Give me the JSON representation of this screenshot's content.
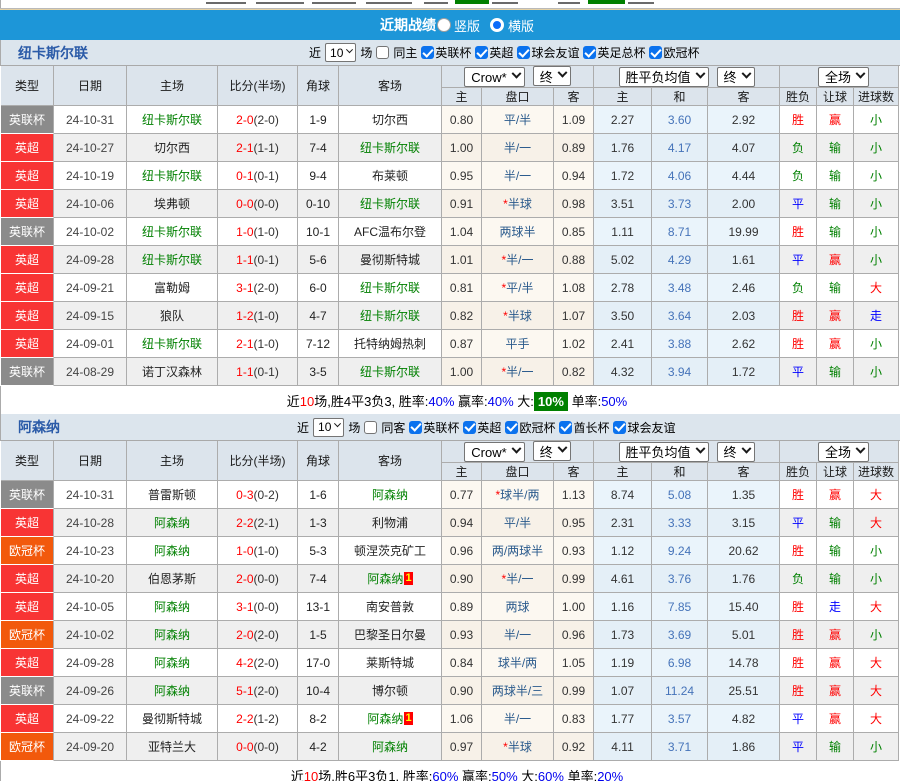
{
  "header": {
    "title": "近期战绩",
    "view_options": [
      {
        "label": "竖版",
        "selected": true
      },
      {
        "label": "横版",
        "selected": false
      }
    ]
  },
  "top_strip": {
    "fragments": [
      [
        206,
        40
      ],
      [
        256,
        48
      ],
      [
        312,
        44
      ],
      [
        366,
        46
      ],
      [
        424,
        24
      ],
      [
        492,
        26
      ],
      [
        558,
        22
      ],
      [
        628,
        26
      ]
    ],
    "green_boxes": [
      [
        455,
        34
      ],
      [
        588,
        37
      ]
    ]
  },
  "columns": {
    "left": [
      "类型",
      "日期",
      "主场",
      "比分(半场)",
      "角球",
      "客场"
    ],
    "bookmaker_select": "Crow*",
    "bookmaker_final_select": "终",
    "odds_sub": [
      "主",
      "盘口",
      "客"
    ],
    "europe_select": "胜平负均值",
    "europe_final_select": "终",
    "europe_sub": [
      "主",
      "和",
      "客"
    ],
    "scope_select": "全场",
    "result_sub": [
      "胜负",
      "让球",
      "进球数"
    ]
  },
  "league_colors": {
    "英超": "#F83434",
    "英联杯": "#8B8B8B",
    "欧冠杯": "#F2590C"
  },
  "result_colors": {
    "胜": "#FF0000",
    "平": "#0000FF",
    "负": "#008000",
    "赢": "#FF0000",
    "输": "#008000",
    "走": "#0000FF",
    "大": "#FF0000",
    "小": "#008000"
  },
  "sections": [
    {
      "team": "纽卡斯尔联",
      "filters": {
        "near": "近",
        "count": "10",
        "unit": "场",
        "same": "同主",
        "same_checked": false,
        "leagues": [
          "英联杯",
          "英超",
          "球会友谊",
          "英足总杯",
          "欧冠杯"
        ]
      },
      "rows": [
        {
          "type": "英联杯",
          "date": "24-10-31",
          "home": "纽卡斯尔联",
          "home_subj": true,
          "home_card": "",
          "score": "2-0",
          "half": "(2-0)",
          "corners": "1-9",
          "away": "切尔西",
          "away_subj": false,
          "away_card": "",
          "o1": "0.80",
          "star": false,
          "hcp": "平/半",
          "o2": "1.09",
          "e1": "2.27",
          "e2": "3.60",
          "e3": "2.92",
          "r1": "胜",
          "r2": "赢",
          "r3": "小"
        },
        {
          "type": "英超",
          "date": "24-10-27",
          "home": "切尔西",
          "home_subj": false,
          "home_card": "",
          "score": "2-1",
          "half": "(1-1)",
          "corners": "7-4",
          "away": "纽卡斯尔联",
          "away_subj": true,
          "away_card": "",
          "o1": "1.00",
          "star": false,
          "hcp": "半/一",
          "o2": "0.89",
          "e1": "1.76",
          "e2": "4.17",
          "e3": "4.07",
          "r1": "负",
          "r2": "输",
          "r3": "小"
        },
        {
          "type": "英超",
          "date": "24-10-19",
          "home": "纽卡斯尔联",
          "home_subj": true,
          "home_card": "",
          "score": "0-1",
          "half": "(0-1)",
          "corners": "9-4",
          "away": "布莱顿",
          "away_subj": false,
          "away_card": "",
          "o1": "0.95",
          "star": false,
          "hcp": "半/一",
          "o2": "0.94",
          "e1": "1.72",
          "e2": "4.06",
          "e3": "4.44",
          "r1": "负",
          "r2": "输",
          "r3": "小"
        },
        {
          "type": "英超",
          "date": "24-10-06",
          "home": "埃弗顿",
          "home_subj": false,
          "home_card": "",
          "score": "0-0",
          "half": "(0-0)",
          "corners": "0-10",
          "away": "纽卡斯尔联",
          "away_subj": true,
          "away_card": "",
          "o1": "0.91",
          "star": true,
          "hcp": "半球",
          "o2": "0.98",
          "e1": "3.51",
          "e2": "3.73",
          "e3": "2.00",
          "r1": "平",
          "r2": "输",
          "r3": "小"
        },
        {
          "type": "英联杯",
          "date": "24-10-02",
          "home": "纽卡斯尔联",
          "home_subj": true,
          "home_card": "",
          "score": "1-0",
          "half": "(1-0)",
          "corners": "10-1",
          "away": "AFC温布尔登",
          "away_subj": false,
          "away_card": "",
          "o1": "1.04",
          "star": false,
          "hcp": "两球半",
          "o2": "0.85",
          "e1": "1.11",
          "e2": "8.71",
          "e3": "19.99",
          "r1": "胜",
          "r2": "输",
          "r3": "小"
        },
        {
          "type": "英超",
          "date": "24-09-28",
          "home": "纽卡斯尔联",
          "home_subj": true,
          "home_card": "",
          "score": "1-1",
          "half": "(0-1)",
          "corners": "5-6",
          "away": "曼彻斯特城",
          "away_subj": false,
          "away_card": "",
          "o1": "1.01",
          "star": true,
          "hcp": "半/一",
          "o2": "0.88",
          "e1": "5.02",
          "e2": "4.29",
          "e3": "1.61",
          "r1": "平",
          "r2": "赢",
          "r3": "小"
        },
        {
          "type": "英超",
          "date": "24-09-21",
          "home": "富勒姆",
          "home_subj": false,
          "home_card": "",
          "score": "3-1",
          "half": "(2-0)",
          "corners": "6-0",
          "away": "纽卡斯尔联",
          "away_subj": true,
          "away_card": "",
          "o1": "0.81",
          "star": true,
          "hcp": "平/半",
          "o2": "1.08",
          "e1": "2.78",
          "e2": "3.48",
          "e3": "2.46",
          "r1": "负",
          "r2": "输",
          "r3": "大"
        },
        {
          "type": "英超",
          "date": "24-09-15",
          "home": "狼队",
          "home_subj": false,
          "home_card": "",
          "score": "1-2",
          "half": "(1-0)",
          "corners": "4-7",
          "away": "纽卡斯尔联",
          "away_subj": true,
          "away_card": "",
          "o1": "0.82",
          "star": true,
          "hcp": "半球",
          "o2": "1.07",
          "e1": "3.50",
          "e2": "3.64",
          "e3": "2.03",
          "r1": "胜",
          "r2": "赢",
          "r3": "走"
        },
        {
          "type": "英超",
          "date": "24-09-01",
          "home": "纽卡斯尔联",
          "home_subj": true,
          "home_card": "",
          "score": "2-1",
          "half": "(1-0)",
          "corners": "7-12",
          "away": "托特纳姆热刺",
          "away_subj": false,
          "away_card": "",
          "o1": "0.87",
          "star": false,
          "hcp": "平手",
          "o2": "1.02",
          "e1": "2.41",
          "e2": "3.88",
          "e3": "2.62",
          "r1": "胜",
          "r2": "赢",
          "r3": "小"
        },
        {
          "type": "英联杯",
          "date": "24-08-29",
          "home": "诺丁汉森林",
          "home_subj": false,
          "home_card": "",
          "score": "1-1",
          "half": "(0-1)",
          "corners": "3-5",
          "away": "纽卡斯尔联",
          "away_subj": true,
          "away_card": "",
          "o1": "1.00",
          "star": true,
          "hcp": "半/一",
          "o2": "0.82",
          "e1": "4.32",
          "e2": "3.94",
          "e3": "1.72",
          "r1": "平",
          "r2": "输",
          "r3": "小"
        }
      ],
      "summary": [
        [
          "近",
          ""
        ],
        [
          "10",
          "red"
        ],
        [
          "场,胜4平3负3, 胜率:",
          ""
        ],
        [
          "40%",
          "pct"
        ],
        [
          " 赢率:",
          ""
        ],
        [
          "40%",
          "pct"
        ],
        [
          " 大:",
          ""
        ],
        [
          "10%",
          "gbox"
        ],
        [
          " 单率:",
          ""
        ],
        [
          "50%",
          "pct"
        ]
      ]
    },
    {
      "team": "阿森纳",
      "filters": {
        "near": "近",
        "count": "10",
        "unit": "场",
        "same": "同客",
        "same_checked": false,
        "leagues": [
          "英联杯",
          "英超",
          "欧冠杯",
          "酋长杯",
          "球会友谊"
        ]
      },
      "rows": [
        {
          "type": "英联杯",
          "date": "24-10-31",
          "home": "普雷斯顿",
          "home_subj": false,
          "home_card": "",
          "score": "0-3",
          "half": "(0-2)",
          "corners": "1-6",
          "away": "阿森纳",
          "away_subj": true,
          "away_card": "",
          "o1": "0.77",
          "star": true,
          "hcp": "球半/两",
          "o2": "1.13",
          "e1": "8.74",
          "e2": "5.08",
          "e3": "1.35",
          "r1": "胜",
          "r2": "赢",
          "r3": "大"
        },
        {
          "type": "英超",
          "date": "24-10-28",
          "home": "阿森纳",
          "home_subj": true,
          "home_card": "",
          "score": "2-2",
          "half": "(2-1)",
          "corners": "1-3",
          "away": "利物浦",
          "away_subj": false,
          "away_card": "",
          "o1": "0.94",
          "star": false,
          "hcp": "平/半",
          "o2": "0.95",
          "e1": "2.31",
          "e2": "3.33",
          "e3": "3.15",
          "r1": "平",
          "r2": "输",
          "r3": "大"
        },
        {
          "type": "欧冠杯",
          "date": "24-10-23",
          "home": "阿森纳",
          "home_subj": true,
          "home_card": "",
          "score": "1-0",
          "half": "(1-0)",
          "corners": "5-3",
          "away": "顿涅茨克矿工",
          "away_subj": false,
          "away_card": "",
          "o1": "0.96",
          "star": false,
          "hcp": "两/两球半",
          "o2": "0.93",
          "e1": "1.12",
          "e2": "9.24",
          "e3": "20.62",
          "r1": "胜",
          "r2": "输",
          "r3": "小"
        },
        {
          "type": "英超",
          "date": "24-10-20",
          "home": "伯恩茅斯",
          "home_subj": false,
          "home_card": "",
          "score": "2-0",
          "half": "(0-0)",
          "corners": "7-4",
          "away": "阿森纳",
          "away_subj": true,
          "away_card": "1",
          "o1": "0.90",
          "star": true,
          "hcp": "半/一",
          "o2": "0.99",
          "e1": "4.61",
          "e2": "3.76",
          "e3": "1.76",
          "r1": "负",
          "r2": "输",
          "r3": "小"
        },
        {
          "type": "英超",
          "date": "24-10-05",
          "home": "阿森纳",
          "home_subj": true,
          "home_card": "",
          "score": "3-1",
          "half": "(0-0)",
          "corners": "13-1",
          "away": "南安普敦",
          "away_subj": false,
          "away_card": "",
          "o1": "0.89",
          "star": false,
          "hcp": "两球",
          "o2": "1.00",
          "e1": "1.16",
          "e2": "7.85",
          "e3": "15.40",
          "r1": "胜",
          "r2": "走",
          "r3": "大"
        },
        {
          "type": "欧冠杯",
          "date": "24-10-02",
          "home": "阿森纳",
          "home_subj": true,
          "home_card": "",
          "score": "2-0",
          "half": "(2-0)",
          "corners": "1-5",
          "away": "巴黎圣日尔曼",
          "away_subj": false,
          "away_card": "",
          "o1": "0.93",
          "star": false,
          "hcp": "半/一",
          "o2": "0.96",
          "e1": "1.73",
          "e2": "3.69",
          "e3": "5.01",
          "r1": "胜",
          "r2": "赢",
          "r3": "小"
        },
        {
          "type": "英超",
          "date": "24-09-28",
          "home": "阿森纳",
          "home_subj": true,
          "home_card": "",
          "score": "4-2",
          "half": "(2-0)",
          "corners": "17-0",
          "away": "莱斯特城",
          "away_subj": false,
          "away_card": "",
          "o1": "0.84",
          "star": false,
          "hcp": "球半/两",
          "o2": "1.05",
          "e1": "1.19",
          "e2": "6.98",
          "e3": "14.78",
          "r1": "胜",
          "r2": "赢",
          "r3": "大"
        },
        {
          "type": "英联杯",
          "date": "24-09-26",
          "home": "阿森纳",
          "home_subj": true,
          "home_card": "",
          "score": "5-1",
          "half": "(2-0)",
          "corners": "10-4",
          "away": "博尔顿",
          "away_subj": false,
          "away_card": "",
          "o1": "0.90",
          "star": false,
          "hcp": "两球半/三",
          "o2": "0.99",
          "e1": "1.07",
          "e2": "11.24",
          "e3": "25.51",
          "r1": "胜",
          "r2": "赢",
          "r3": "大"
        },
        {
          "type": "英超",
          "date": "24-09-22",
          "home": "曼彻斯特城",
          "home_subj": false,
          "home_card": "",
          "score": "2-2",
          "half": "(1-2)",
          "corners": "8-2",
          "away": "阿森纳",
          "away_subj": true,
          "away_card": "1",
          "o1": "1.06",
          "star": false,
          "hcp": "半/一",
          "o2": "0.83",
          "e1": "1.77",
          "e2": "3.57",
          "e3": "4.82",
          "r1": "平",
          "r2": "赢",
          "r3": "大"
        },
        {
          "type": "欧冠杯",
          "date": "24-09-20",
          "home": "亚特兰大",
          "home_subj": false,
          "home_card": "",
          "score": "0-0",
          "half": "(0-0)",
          "corners": "4-2",
          "away": "阿森纳",
          "away_subj": true,
          "away_card": "",
          "o1": "0.97",
          "star": true,
          "hcp": "半球",
          "o2": "0.92",
          "e1": "4.11",
          "e2": "3.71",
          "e3": "1.86",
          "r1": "平",
          "r2": "输",
          "r3": "小"
        }
      ],
      "summary": [
        [
          "近",
          ""
        ],
        [
          "10",
          "red"
        ],
        [
          "场,胜6平3负1, 胜率:",
          ""
        ],
        [
          "60%",
          "pct"
        ],
        [
          " 赢率:",
          ""
        ],
        [
          "50%",
          "pct"
        ],
        [
          " 大:",
          ""
        ],
        [
          "60%",
          "pct"
        ],
        [
          " 单率:",
          ""
        ],
        [
          "20%",
          "pct"
        ]
      ]
    }
  ]
}
